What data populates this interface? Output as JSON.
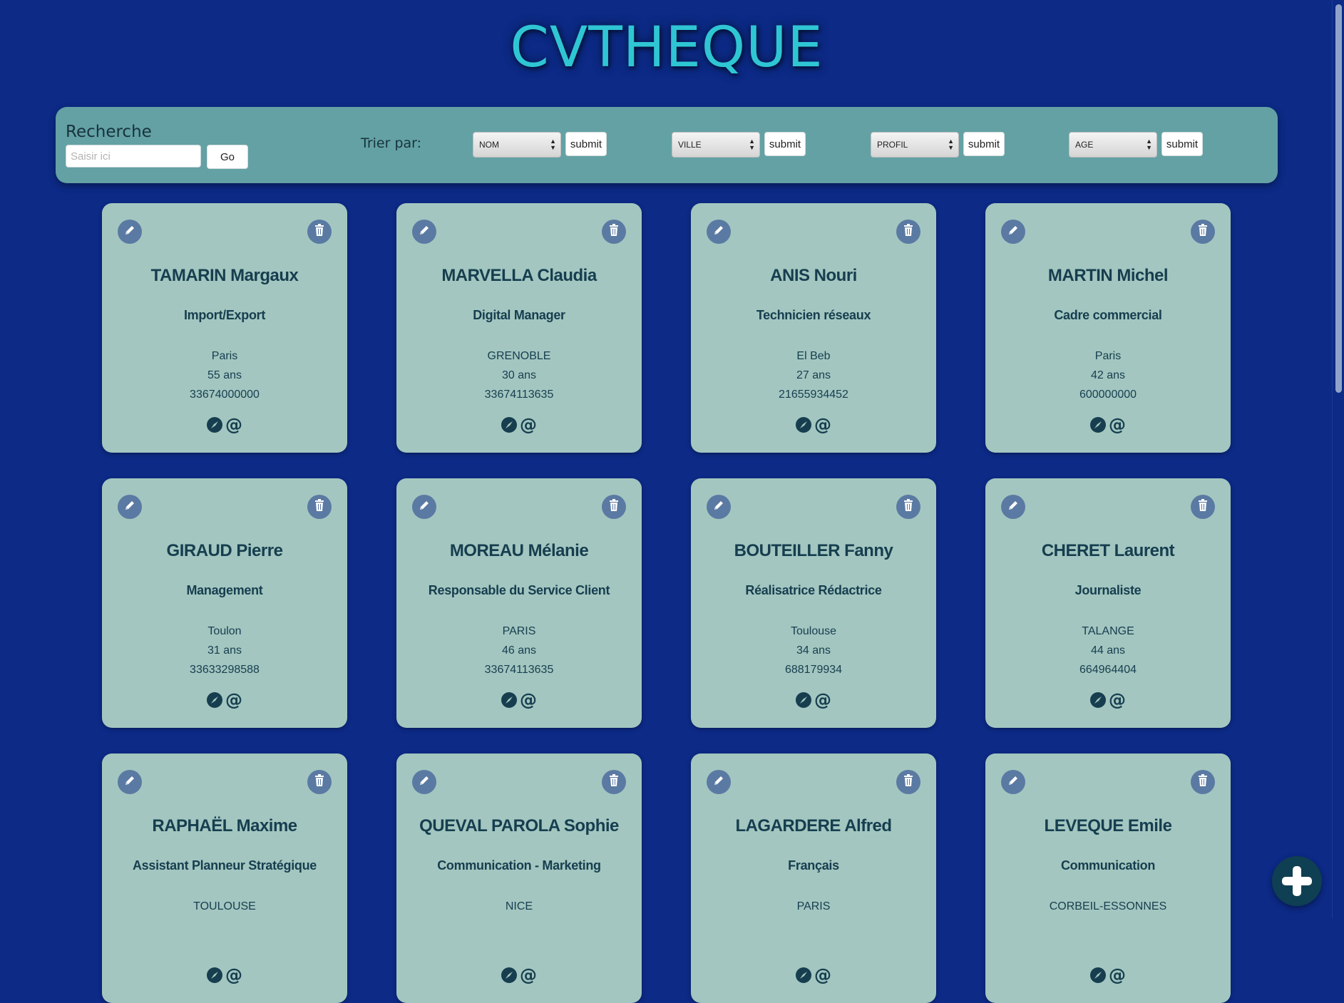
{
  "app": {
    "title": "CVTHEQUE"
  },
  "search": {
    "label": "Recherche",
    "placeholder": "Saisir ici",
    "value": "",
    "go_label": "Go"
  },
  "sort": {
    "label": "Trier par:",
    "selects": [
      {
        "value": "NOM",
        "submit_label": "submit"
      },
      {
        "value": "VILLE",
        "submit_label": "submit"
      },
      {
        "value": "PROFIL",
        "submit_label": "submit"
      },
      {
        "value": "AGE",
        "submit_label": "submit"
      }
    ]
  },
  "cards": [
    {
      "name": "TAMARIN Margaux",
      "profile": "Import/Export",
      "city": "Paris",
      "age": "55 ans",
      "phone": "33674000000"
    },
    {
      "name": "MARVELLA Claudia",
      "profile": "Digital Manager",
      "city": "GRENOBLE",
      "age": "30 ans",
      "phone": "33674113635"
    },
    {
      "name": "ANIS Nouri",
      "profile": "Technicien réseaux",
      "city": "El Beb",
      "age": "27 ans",
      "phone": "21655934452"
    },
    {
      "name": "MARTIN Michel",
      "profile": "Cadre commercial",
      "city": "Paris",
      "age": "42 ans",
      "phone": "600000000"
    },
    {
      "name": "GIRAUD Pierre",
      "profile": "Management",
      "city": "Toulon",
      "age": "31 ans",
      "phone": "33633298588"
    },
    {
      "name": "MOREAU Mélanie",
      "profile": "Responsable du Service Client",
      "city": "PARIS",
      "age": "46 ans",
      "phone": "33674113635"
    },
    {
      "name": "BOUTEILLER Fanny",
      "profile": "Réalisatrice Rédactrice",
      "city": "Toulouse",
      "age": "34 ans",
      "phone": "688179934"
    },
    {
      "name": "CHERET Laurent",
      "profile": "Journaliste",
      "city": "TALANGE",
      "age": "44 ans",
      "phone": "664964404"
    },
    {
      "name": "RAPHAËL Maxime",
      "profile": "Assistant Planneur Stratégique",
      "city": "TOULOUSE",
      "age": "",
      "phone": ""
    },
    {
      "name": "QUEVAL PAROLA Sophie",
      "profile": "Communication - Marketing",
      "city": "NICE",
      "age": "",
      "phone": ""
    },
    {
      "name": "LAGARDERE Alfred",
      "profile": "Français",
      "city": "PARIS",
      "age": "",
      "phone": ""
    },
    {
      "name": "LEVEQUE Emile",
      "profile": "Communication",
      "city": "CORBEIL-ESSONNES",
      "age": "",
      "phone": ""
    }
  ],
  "icons": {
    "edit": "pencil-icon",
    "delete": "trash-icon",
    "website": "compass-icon",
    "email": "at-icon",
    "add": "plus-icon"
  },
  "colors": {
    "background": "#0c2a86",
    "title": "#2fc6d4",
    "searchbar": "#63a1a4",
    "card": "#a3c6c0",
    "card_text": "#163e4f",
    "icon_button": "#5a7aa3"
  }
}
